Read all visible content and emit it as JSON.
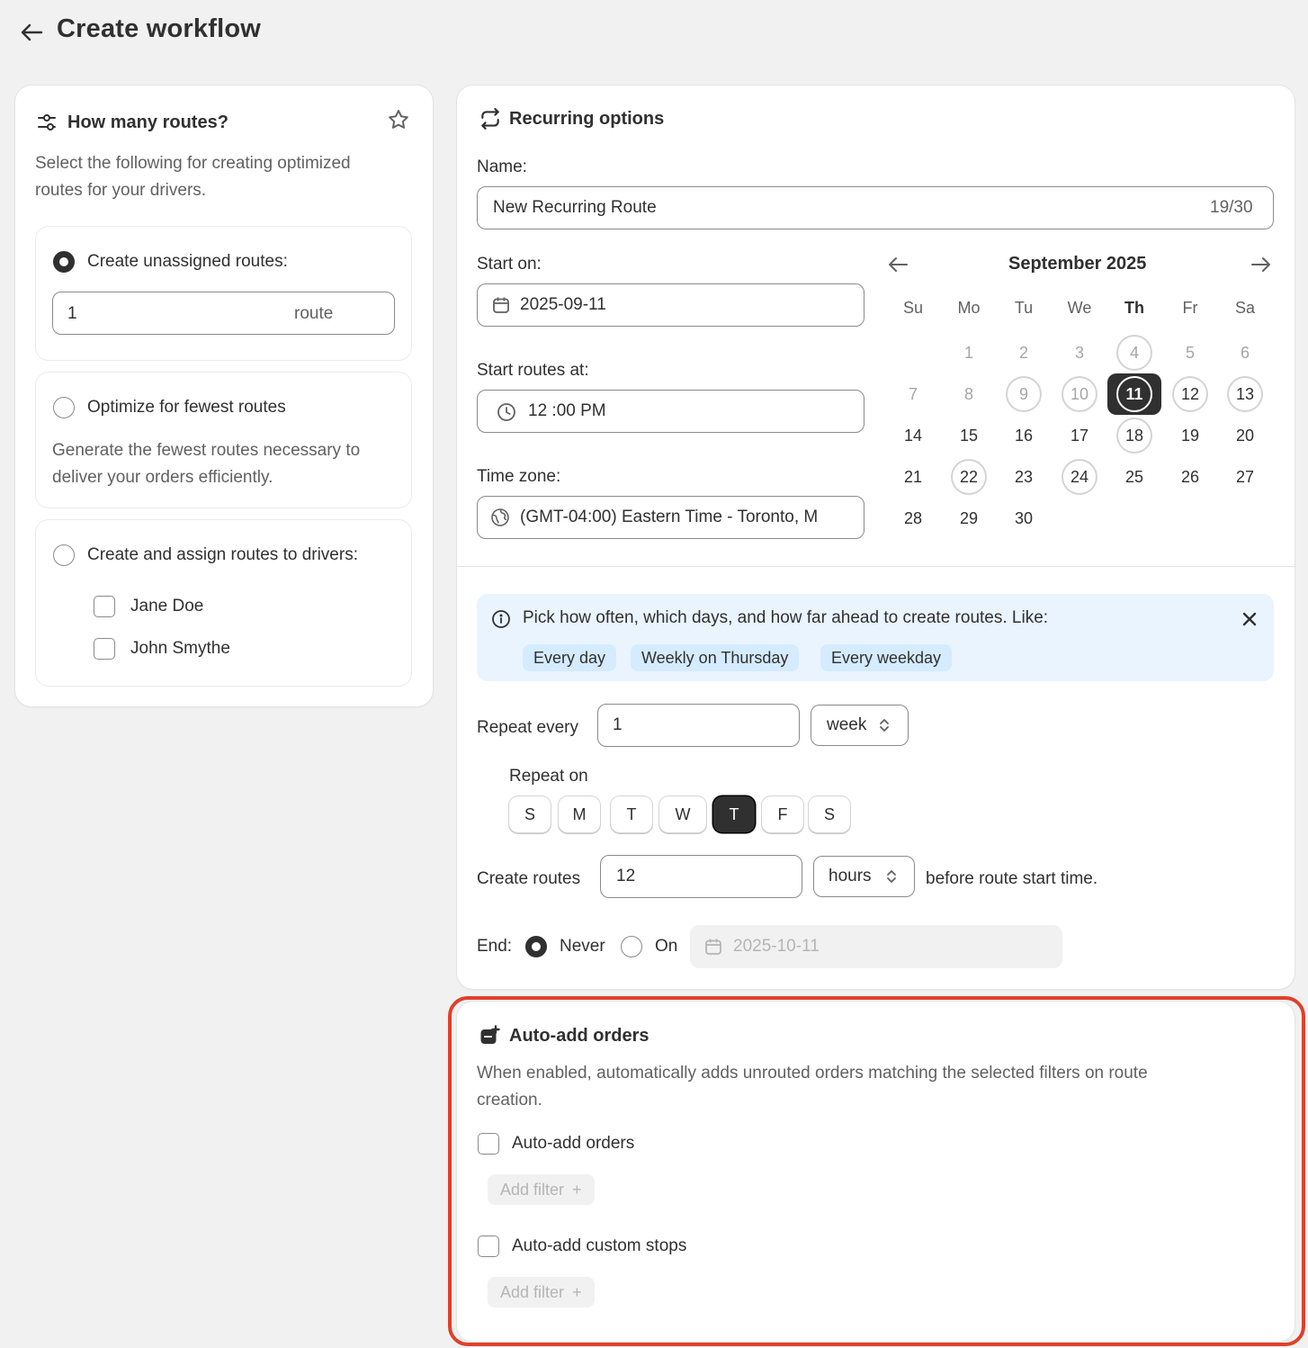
{
  "header": {
    "title": "Create workflow"
  },
  "routes_card": {
    "title": "How many routes?",
    "description_line1": "Select the following for creating optimized",
    "description_line2": "routes for your drivers.",
    "option_unassigned": {
      "label": "Create unassigned routes:",
      "value": "1",
      "suffix": "route"
    },
    "option_fewest": {
      "label": "Optimize for fewest routes",
      "help_line1": "Generate the fewest routes necessary to",
      "help_line2": "deliver your orders efficiently."
    },
    "option_assign": {
      "label": "Create and assign routes to drivers:",
      "drivers": [
        "Jane Doe",
        "John Smythe"
      ]
    }
  },
  "recurring": {
    "title": "Recurring options",
    "name_label": "Name:",
    "name_value": "New Recurring Route",
    "name_count": "19/30",
    "start_on_label": "Start on:",
    "start_on_value": "2025-09-11",
    "start_at_label": "Start routes at:",
    "start_at_value": "12 :00 PM",
    "timezone_label": "Time zone:",
    "timezone_value": "(GMT-04:00) Eastern Time - Toronto, M",
    "calendar": {
      "month": "September 2025",
      "weekdays": [
        "Su",
        "Mo",
        "Tu",
        "We",
        "Th",
        "Fr",
        "Sa"
      ],
      "selected": "11"
    },
    "banner": {
      "text": "Pick how often, which days, and how far ahead to create routes. Like:",
      "chips": [
        "Every day",
        "Weekly on Thursday",
        "Every weekday"
      ]
    },
    "repeat_every_label": "Repeat every",
    "repeat_every_value": "1",
    "repeat_unit": "week",
    "repeat_on_label": "Repeat on",
    "repeat_days": [
      "S",
      "M",
      "T",
      "W",
      "T",
      "F",
      "S"
    ],
    "repeat_selected_index": 4,
    "create_routes_label": "Create routes",
    "create_routes_value": "12",
    "create_routes_unit": "hours",
    "create_routes_suffix": "before route start time.",
    "end_label": "End:",
    "end_never": "Never",
    "end_on": "On",
    "end_date_placeholder": "2025-10-11"
  },
  "auto_add": {
    "title": "Auto-add orders",
    "description_line1": "When enabled, automatically adds unrouted orders matching the selected filters on route",
    "description_line2": "creation.",
    "orders_label": "Auto-add orders",
    "stops_label": "Auto-add custom stops",
    "add_filter": "Add filter"
  },
  "colors": {
    "background": "#f1f1f1",
    "text": "#303030",
    "highlight": "#e0402b",
    "banner": "#eaf4ff",
    "chip": "#d5ebff"
  }
}
